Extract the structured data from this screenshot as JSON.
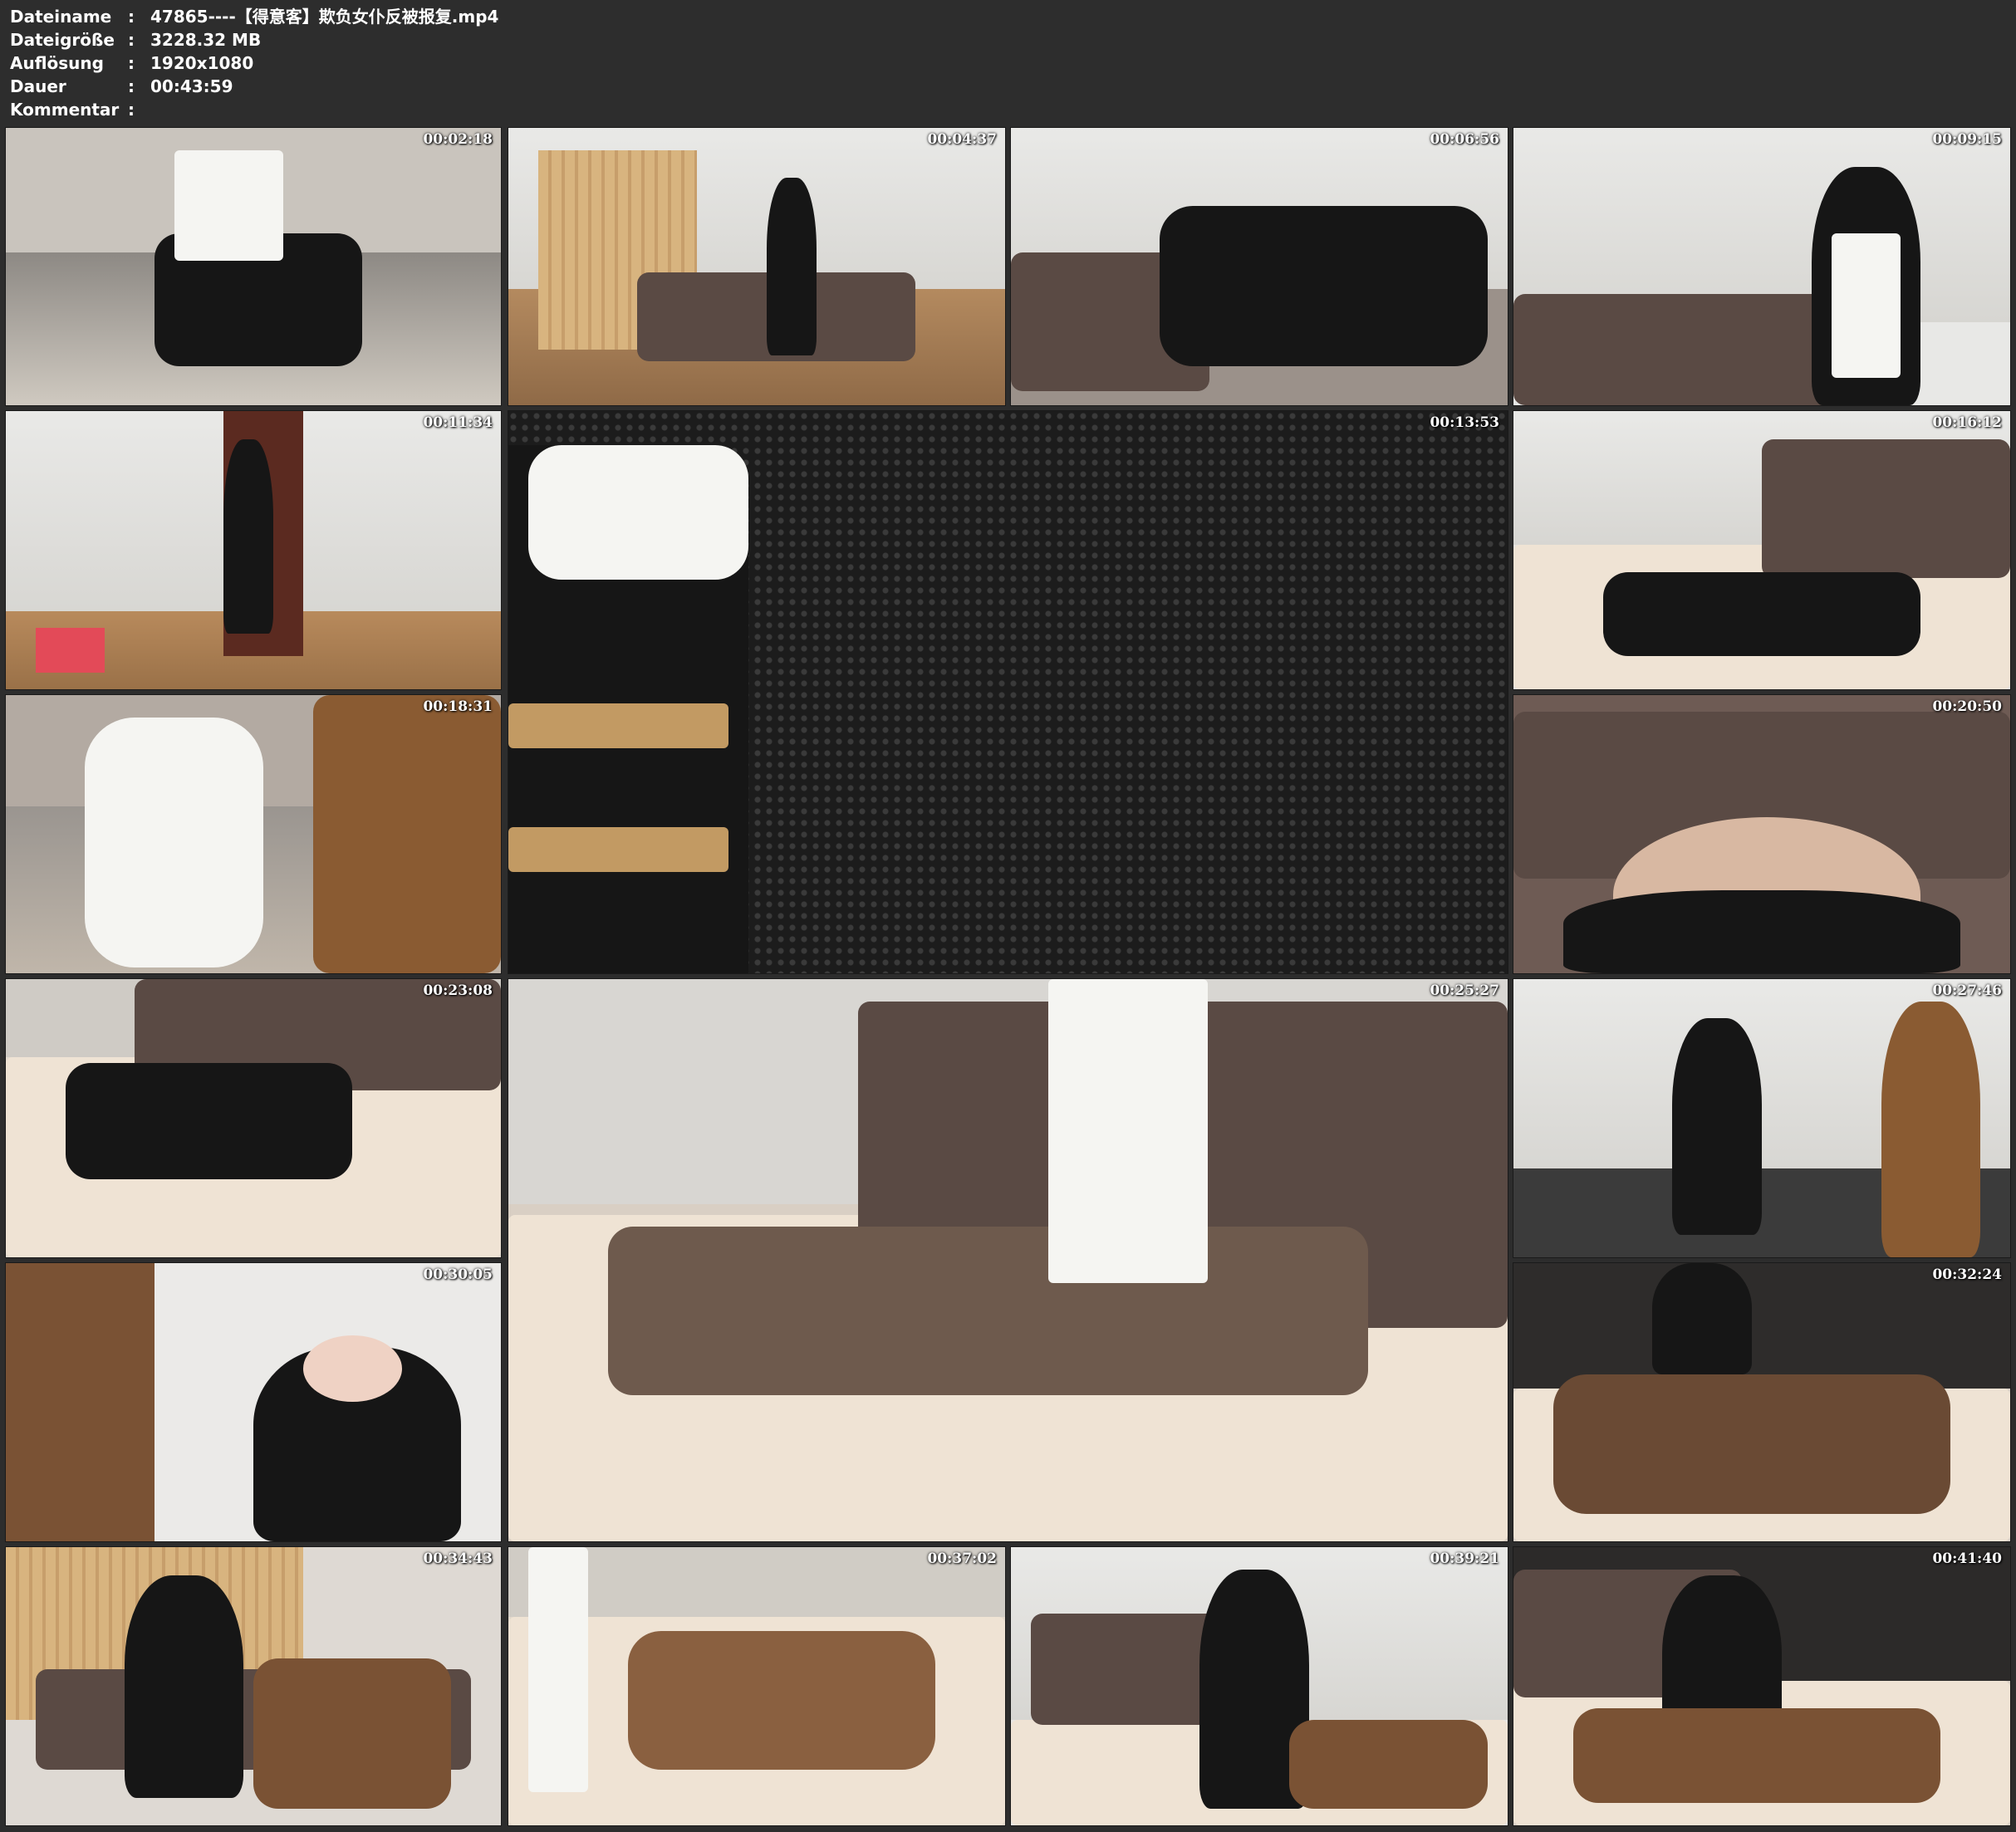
{
  "info": {
    "rows": [
      {
        "key": "Dateiname",
        "value": "47865----【得意客】欺负女仆反被报复.mp4"
      },
      {
        "key": "Dateigröße",
        "value": "3228.32 MB"
      },
      {
        "key": "Auflösung",
        "value": "1920x1080"
      },
      {
        "key": "Dauer",
        "value": "00:43:59"
      },
      {
        "key": "Kommentar",
        "value": ""
      }
    ],
    "colon": ":"
  },
  "thumbnails": [
    {
      "timestamp": "00:02:18",
      "scene": "maid-shoes-closeup"
    },
    {
      "timestamp": "00:04:37",
      "scene": "room-screen-sofa"
    },
    {
      "timestamp": "00:06:56",
      "scene": "sofa-kneeling"
    },
    {
      "timestamp": "00:09:15",
      "scene": "sofa-standing-maid"
    },
    {
      "timestamp": "00:11:34",
      "scene": "door-maid"
    },
    {
      "timestamp": "00:13:53",
      "scene": "dark-wall-closeup"
    },
    {
      "timestamp": "00:16:12",
      "scene": "rug-floor"
    },
    {
      "timestamp": "00:18:31",
      "scene": "sock-closeup"
    },
    {
      "timestamp": "00:20:50",
      "scene": "sofa-phone"
    },
    {
      "timestamp": "00:23:08",
      "scene": "rug-floor"
    },
    {
      "timestamp": "00:25:27",
      "scene": "sofa-floor-large"
    },
    {
      "timestamp": "00:27:46",
      "scene": "wall-standing"
    },
    {
      "timestamp": "00:30:05",
      "scene": "maid-portrait"
    },
    {
      "timestamp": "00:32:24",
      "scene": "dark-wall-floor"
    },
    {
      "timestamp": "00:34:43",
      "scene": "room-screen-sofa"
    },
    {
      "timestamp": "00:37:02",
      "scene": "rug-floor"
    },
    {
      "timestamp": "00:39:21",
      "scene": "sofa-floor"
    },
    {
      "timestamp": "00:41:40",
      "scene": "dark-wall-floor"
    }
  ],
  "colors": {
    "background": "#2d2d2d",
    "text": "#ffffff"
  }
}
